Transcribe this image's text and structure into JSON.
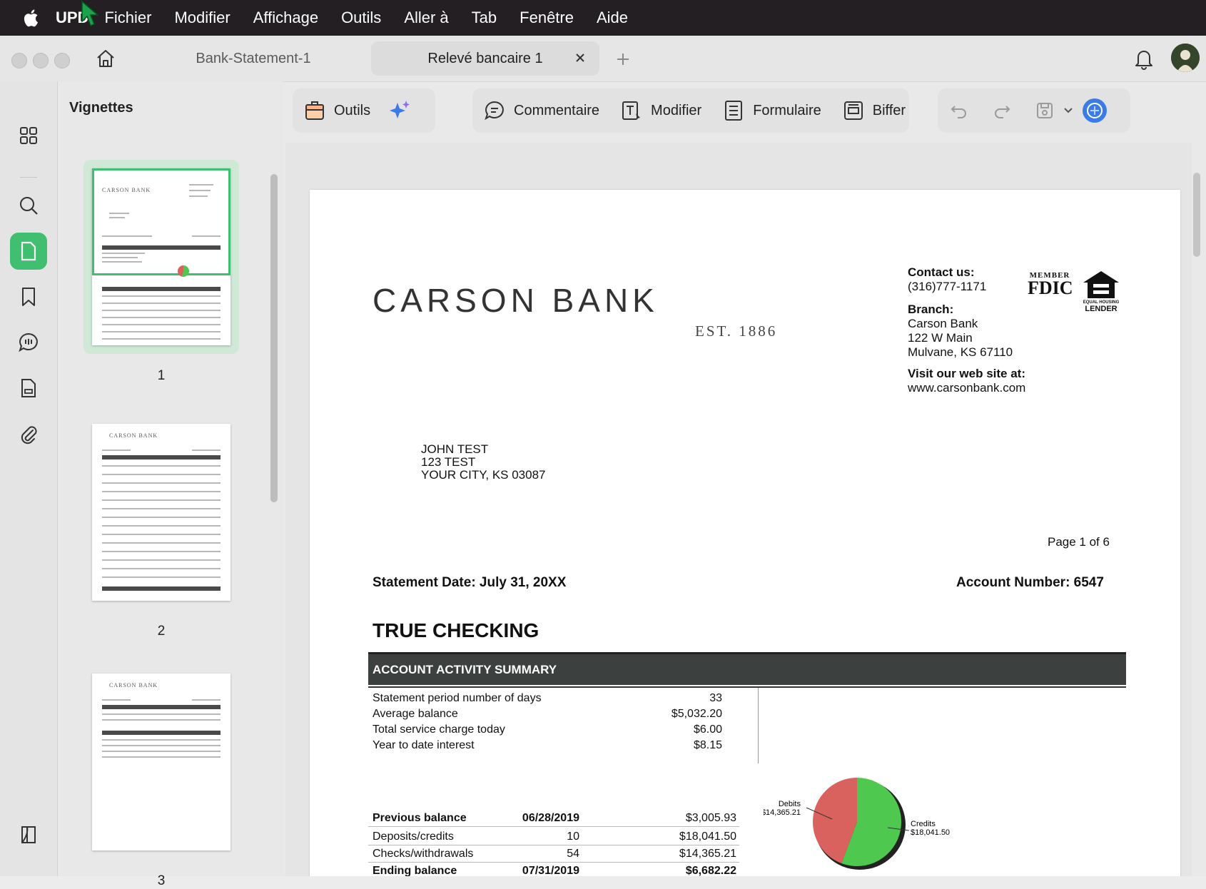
{
  "menubar": {
    "app_name": "UPD",
    "items": [
      "Fichier",
      "Modifier",
      "Affichage",
      "Outils",
      "Aller à",
      "Tab",
      "Fenêtre",
      "Aide"
    ]
  },
  "tabs": [
    {
      "label": "Bank-Statement-1",
      "active": false
    },
    {
      "label": "Relevé bancaire 1",
      "active": true
    }
  ],
  "panel": {
    "title": "Vignettes",
    "pages": [
      "1",
      "2",
      "3"
    ]
  },
  "toolbar": {
    "tools_label": "Outils",
    "comment_label": "Commentaire",
    "edit_label": "Modifier",
    "form_label": "Formulaire",
    "redact_label": "Biffer"
  },
  "colors": {
    "accent": "#3fbf6f",
    "summary_bar": "#3c403f",
    "pie_debits": "#d9625f",
    "pie_credits": "#4fc84f"
  },
  "document": {
    "bank_name": "CARSON BANK",
    "bank_est": "EST. 1886",
    "contact_heading": "Contact us:",
    "contact_phone": "(316)777-1171",
    "branch_heading": "Branch:",
    "branch_lines": [
      "Carson Bank",
      "122 W Main",
      "Mulvane, KS 67110"
    ],
    "web_heading": "Visit our web site at:",
    "web_url": "www.carsonbank.com",
    "fdic_member": "MEMBER",
    "fdic": "FDIC",
    "ehl_line1": "EQUAL HOUSING",
    "ehl_line2": "LENDER",
    "address": [
      "JOHN TEST",
      "123 TEST",
      "YOUR CITY, KS 03087"
    ],
    "page_label": "Page 1 of 6",
    "statement_date": "Statement Date:  July 31, 20XX",
    "account_number": "Account Number:  6547",
    "section_title": "TRUE CHECKING",
    "summary_heading": "ACCOUNT ACTIVITY SUMMARY",
    "summary": [
      {
        "label": "Statement period number of days",
        "value": "33"
      },
      {
        "label": "Average balance",
        "value": "$5,032.20"
      },
      {
        "label": "Total service charge today",
        "value": "$6.00"
      },
      {
        "label": "Year to date interest",
        "value": "$8.15"
      }
    ],
    "balances": [
      {
        "label": "Previous balance",
        "mid": "06/28/2019",
        "amount": "$3,005.93"
      },
      {
        "label": "Deposits/credits",
        "mid": "10",
        "amount": "$18,041.50"
      },
      {
        "label": "Checks/withdrawals",
        "mid": "54",
        "amount": "$14,365.21"
      },
      {
        "label": "Ending balance",
        "mid": "07/31/2019",
        "amount": "$6,682.22"
      }
    ],
    "pie": {
      "debits_label": "Debits",
      "debits_value": "$14,365.21",
      "credits_label": "Credits",
      "credits_value": "$18,041.50",
      "debits": 14365.21,
      "credits": 18041.5
    }
  }
}
